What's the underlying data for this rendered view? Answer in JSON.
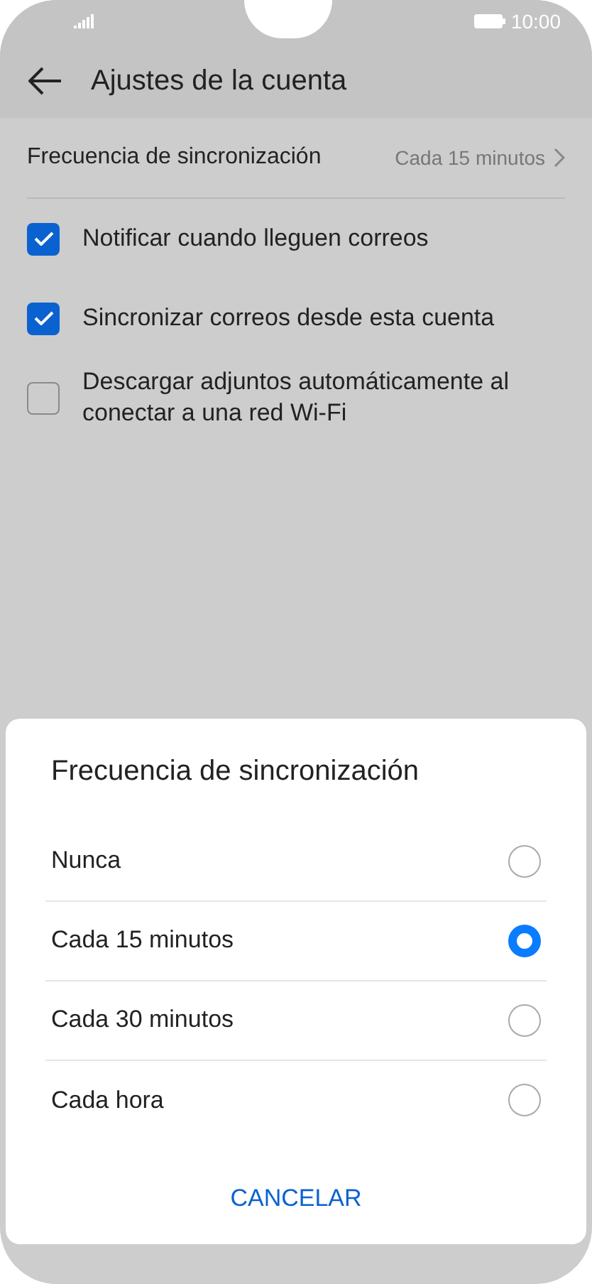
{
  "status_bar": {
    "time": "10:00"
  },
  "header": {
    "title": "Ajustes de la cuenta"
  },
  "settings": {
    "sync_frequency": {
      "label": "Frecuencia de sincronización",
      "value": "Cada 15 minutos"
    },
    "options": [
      {
        "label": "Notificar cuando lleguen correos",
        "checked": true
      },
      {
        "label": "Sincronizar correos desde esta cuenta",
        "checked": true
      },
      {
        "label": "Descargar adjuntos automáticamente al conectar a una red Wi-Fi",
        "checked": false
      }
    ]
  },
  "dialog": {
    "title": "Frecuencia de sincronización",
    "choices": [
      {
        "label": "Nunca",
        "selected": false
      },
      {
        "label": "Cada 15 minutos",
        "selected": true
      },
      {
        "label": "Cada 30 minutos",
        "selected": false
      },
      {
        "label": "Cada hora",
        "selected": false
      }
    ],
    "cancel": "CANCELAR"
  }
}
